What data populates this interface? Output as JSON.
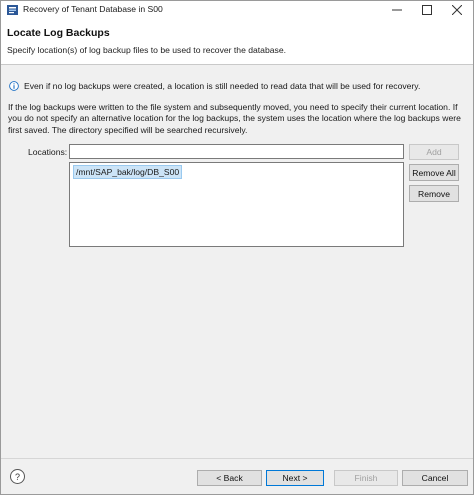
{
  "window": {
    "title": "Recovery of Tenant Database in S00"
  },
  "header": {
    "title": "Locate Log Backups",
    "subtitle": "Specify location(s) of log backup files to be used to recover the database."
  },
  "info": {
    "text": "Even if no log backups were created, a location is still needed to read data that will be used for recovery."
  },
  "description": {
    "text": "If the log backups were written to the file system and subsequently moved, you need to specify their current location. If you do not specify an alternative location for the log backups, the system uses the location where the log backups were first saved. The directory specified will be searched recursively."
  },
  "locations": {
    "label": "Locations:",
    "input_value": "",
    "items": [
      "/mnt/SAP_bak/log/DB_S00"
    ],
    "add_label": "Add",
    "remove_all_label": "Remove All",
    "remove_label": "Remove"
  },
  "footer": {
    "help_label": "?",
    "back_label": "< Back",
    "next_label": "Next >",
    "finish_label": "Finish",
    "cancel_label": "Cancel"
  },
  "icons": {
    "app": "app-icon",
    "info": "info-icon",
    "help": "help-icon"
  },
  "colors": {
    "accent": "#0078d7",
    "selection": "#cce4f7"
  }
}
